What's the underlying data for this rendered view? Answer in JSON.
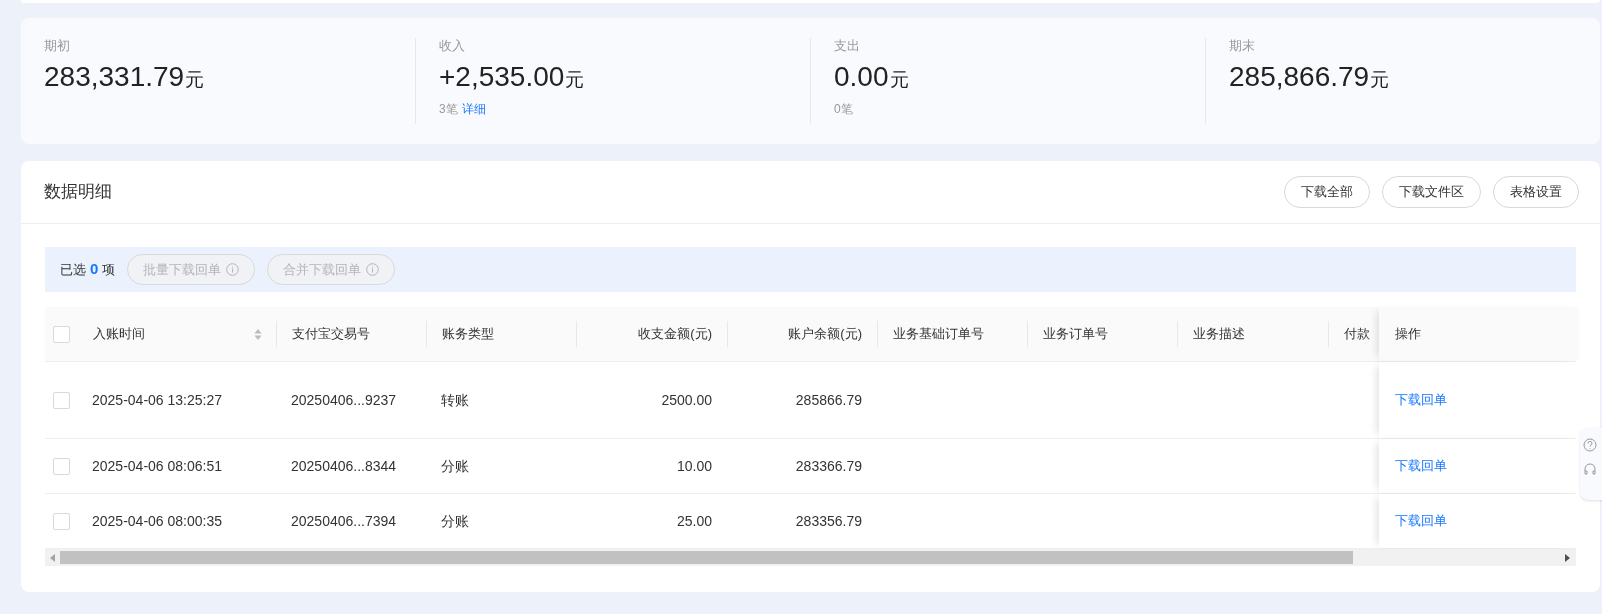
{
  "summary": [
    {
      "label": "期初",
      "value": "283,331.79",
      "unit": "元"
    },
    {
      "label": "收入",
      "value": "+2,535.00",
      "unit": "元",
      "count": "3笔",
      "link": "详细"
    },
    {
      "label": "支出",
      "value": "0.00",
      "unit": "元",
      "count": "0笔"
    },
    {
      "label": "期末",
      "value": "285,866.79",
      "unit": "元"
    }
  ],
  "detail": {
    "title": "数据明细",
    "buttons": [
      "下载全部",
      "下载文件区",
      "表格设置"
    ],
    "selection": {
      "prefix": "已选",
      "count": "0",
      "suffix": "项",
      "buttons": [
        {
          "label": "批量下载回单",
          "disabled": true
        },
        {
          "label": "合并下载回单",
          "disabled": true
        }
      ]
    },
    "table": {
      "all_checked": false,
      "columns": [
        {
          "label": "入账时间",
          "sortable": true,
          "kind": "text"
        },
        {
          "label": "支付宝交易号",
          "kind": "text"
        },
        {
          "label": "账务类型",
          "kind": "text"
        },
        {
          "label": "收支金额(元)",
          "kind": "amount"
        },
        {
          "label": "账户余额(元)",
          "kind": "amount"
        },
        {
          "label": "业务基础订单号",
          "kind": "text"
        },
        {
          "label": "业务订单号",
          "kind": "text"
        },
        {
          "label": "业务描述",
          "kind": "text"
        },
        {
          "label": "付款",
          "kind": "text"
        }
      ],
      "action_column": "操作",
      "rows": [
        {
          "checked": false,
          "cells": [
            "2025-04-06 13:25:27",
            "20250406...9237",
            "转账",
            "2500.00",
            "285866.79"
          ],
          "action": "下载回单"
        },
        {
          "checked": false,
          "cells": [
            "2025-04-06 08:06:51",
            "20250406...8344",
            "分账",
            "10.00",
            "283366.79"
          ],
          "action": "下载回单"
        },
        {
          "checked": false,
          "cells": [
            "2025-04-06 08:00:35",
            "20250406...7394",
            "分账",
            "25.00",
            "283356.79"
          ],
          "action": "下载回单"
        }
      ]
    }
  }
}
